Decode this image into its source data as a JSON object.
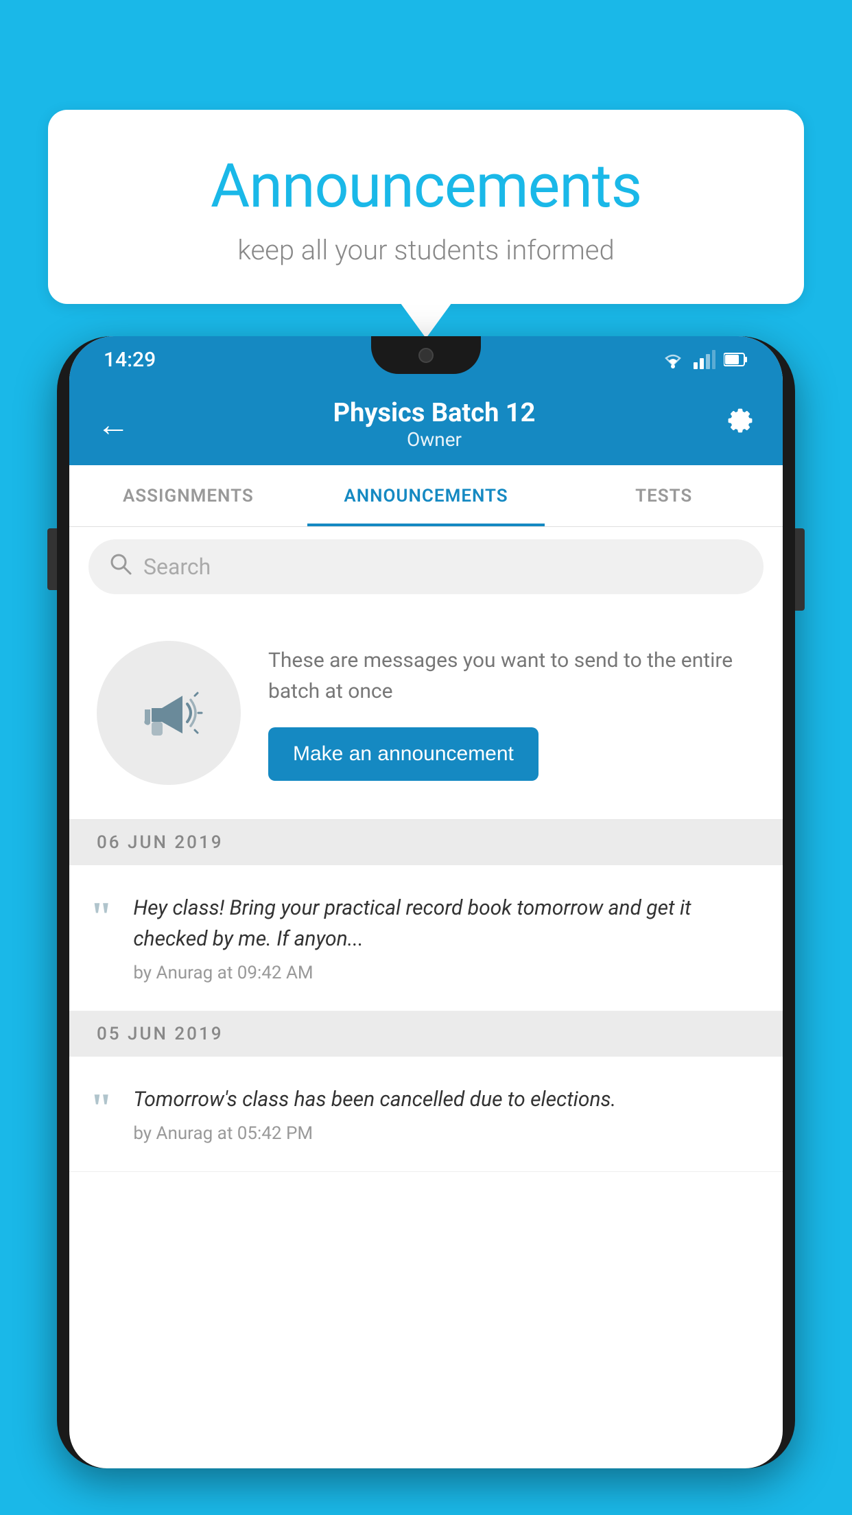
{
  "background_color": "#1ab8e8",
  "speech_bubble": {
    "title": "Announcements",
    "subtitle": "keep all your students informed"
  },
  "phone": {
    "status_bar": {
      "time": "14:29"
    },
    "app_bar": {
      "title": "Physics Batch 12",
      "subtitle": "Owner",
      "back_label": "←",
      "settings_label": "⚙"
    },
    "tabs": [
      {
        "label": "ASSIGNMENTS",
        "active": false
      },
      {
        "label": "ANNOUNCEMENTS",
        "active": true
      },
      {
        "label": "TESTS",
        "active": false
      }
    ],
    "search": {
      "placeholder": "Search"
    },
    "cta": {
      "description": "These are messages you want to send to the entire batch at once",
      "button_label": "Make an announcement"
    },
    "announcements": [
      {
        "date": "06  JUN  2019",
        "text": "Hey class! Bring your practical record book tomorrow and get it checked by me. If anyon...",
        "meta": "by Anurag at 09:42 AM"
      },
      {
        "date": "05  JUN  2019",
        "text": "Tomorrow's class has been cancelled due to elections.",
        "meta": "by Anurag at 05:42 PM"
      }
    ]
  }
}
